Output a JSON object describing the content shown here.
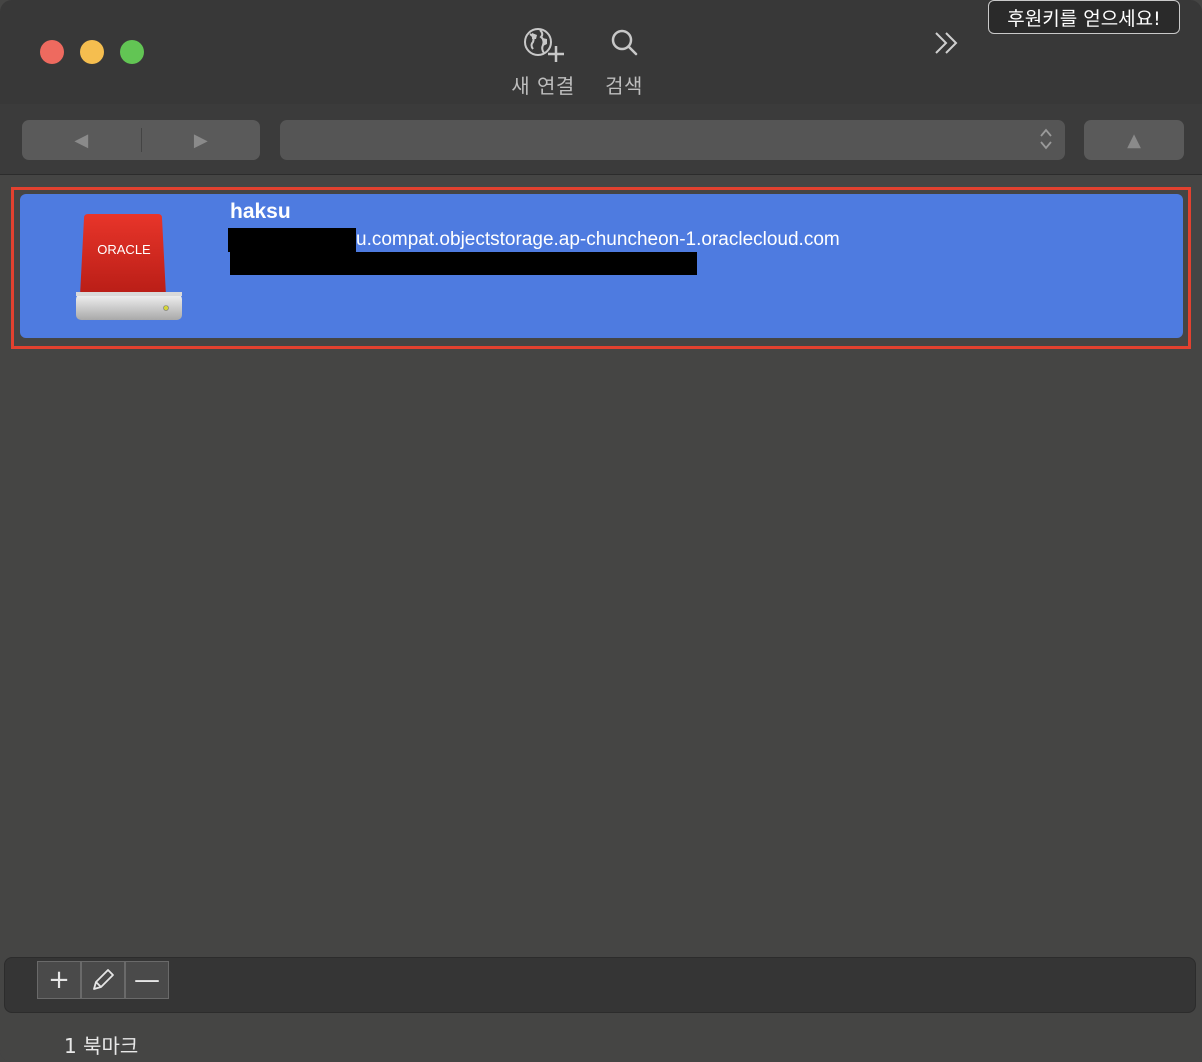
{
  "toolbar": {
    "new_connection_label": "새 연결",
    "search_label": "검색",
    "overflow_glyph": "»",
    "donate_label": "후원키를 얻으세요!"
  },
  "nav": {
    "back_glyph": "◀",
    "forward_glyph": "▶",
    "up_glyph": "▲",
    "path_value": ""
  },
  "bookmarks": [
    {
      "nickname": "haksu",
      "hostname_suffix": "u.compat.objectstorage.ap-chuncheon-1.oraclecloud.com",
      "icon": "oracle-drive-icon",
      "drive_label": "ORACLE"
    }
  ],
  "footer": {
    "add_glyph": "+",
    "delete_glyph": "—",
    "count_label": "1 북마크"
  },
  "colors": {
    "selection": "#4e7be0",
    "highlight_border": "#e2412f",
    "window_bg": "#454544",
    "close": "#ee6a5f",
    "minimize": "#f5be4f",
    "zoom": "#62c554"
  }
}
